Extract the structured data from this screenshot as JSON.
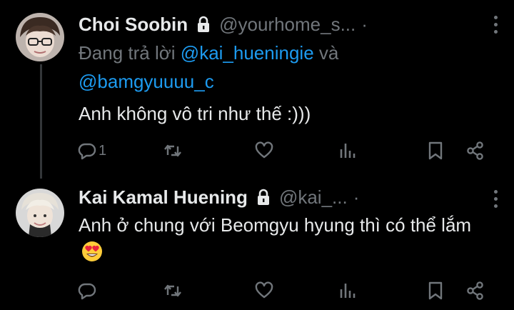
{
  "tweets": [
    {
      "name": "Choi Soobin",
      "handle": "@yourhome_s...",
      "separator": "·",
      "replying_prefix": "Đang trả lời",
      "mention_1": "@kai_hueningie",
      "replying_joiner": "và",
      "mention_2": "@bamgyuuuu_c",
      "text": "Anh không vô tri như thế :)))",
      "reply_count": "1"
    },
    {
      "name": "Kai Kamal Huening",
      "handle": "@kai_...",
      "separator": "·",
      "text": "Anh ở chung với Beomgyu hyung thì có thể lắm",
      "emoji": "😍",
      "reply_count": ""
    }
  ],
  "icons": [
    "lock-icon",
    "more-icon",
    "reply-icon",
    "retweet-icon",
    "like-icon",
    "views-icon",
    "bookmark-icon",
    "share-icon"
  ],
  "colors": {
    "background": "#000000",
    "text": "#e7e9ea",
    "muted": "#71767b",
    "link": "#1d9bf0"
  }
}
